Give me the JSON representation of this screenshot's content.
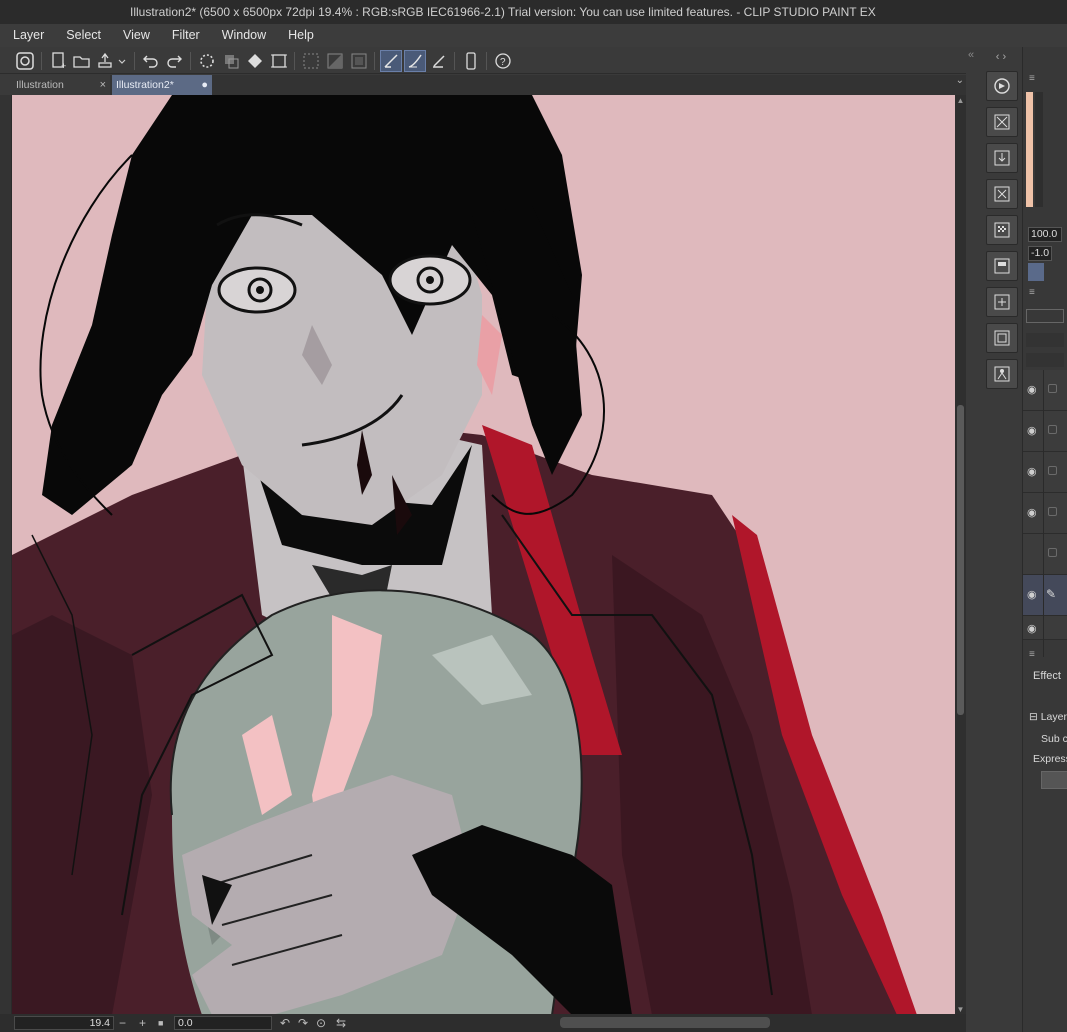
{
  "window": {
    "title": "Illustration2* (6500 x 6500px 72dpi 19.4% : RGB:sRGB IEC61966-2.1)  Trial version: You can use limited features. - CLIP STUDIO PAINT EX"
  },
  "menu": {
    "items": [
      "Layer",
      "Select",
      "View",
      "Filter",
      "Window",
      "Help"
    ]
  },
  "tabs": [
    {
      "label": "Illustration",
      "close": "×"
    },
    {
      "label": "Illustration2*",
      "close": "●"
    }
  ],
  "status": {
    "zoom": "19.4",
    "rotation": "0.0",
    "minus": "−",
    "plus": "+"
  },
  "panels": {
    "opacity_value": "100.0",
    "offset_value": "-1.0",
    "effect_label": "Effect",
    "layer_label": "Layer",
    "sub_label": "Sub c",
    "express_label": "Express"
  },
  "icons": {
    "toolbar": [
      "app-logo-icon",
      "new-icon",
      "open-icon",
      "export-icon",
      "undo-icon",
      "redo-icon",
      "loading-icon",
      "transform-icon",
      "fill-icon",
      "resize-icon",
      "select-all-icon",
      "invert-icon",
      "clear-icon",
      "ruler-icon",
      "brush-snap-icon",
      "vector-icon",
      "smartphone-icon",
      "help-icon"
    ],
    "right": [
      "navigator-icon",
      "material-icon",
      "import-icon",
      "delete-icon",
      "pattern-icon",
      "layout-icon",
      "convert-icon",
      "frame-icon",
      "person-icon"
    ]
  },
  "colors": {
    "canvas_background": "#dfb9bd",
    "active_tab": "#5c6a85",
    "jacket": "#4a1f2a",
    "hair": "#080808",
    "skin": "#c2bdbf",
    "orb": "#98a49d",
    "accent_red": "#b0162a"
  }
}
